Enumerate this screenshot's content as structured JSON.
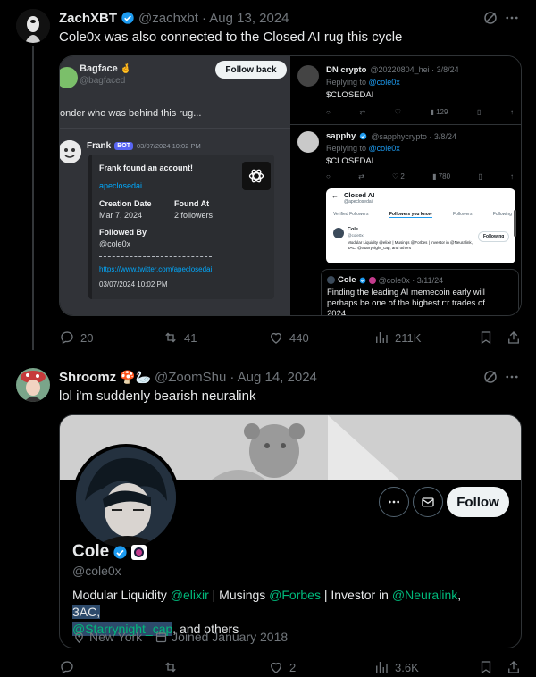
{
  "tweet1": {
    "name": "ZachXBT",
    "handle": "@zachxbt",
    "date": "· Aug 13, 2024",
    "text": "Cole0x was also connected to the Closed AI rug this cycle",
    "actions": {
      "replies": "20",
      "reposts": "41",
      "likes": "440",
      "views": "211K"
    },
    "image": {
      "discord": {
        "top_name": "Bagface",
        "top_emoji": "🤞",
        "top_handle": "@bagfaced",
        "follow_back": "Follow back",
        "quote_text": "onder who was behind this rug...",
        "bot_name": "Frank",
        "bot_tag": "BOT",
        "bot_time": "03/07/2024 10:02 PM",
        "embed_title": "Frank found an account!",
        "embed_account": "apeclosedai",
        "creation_label": "Creation Date",
        "creation_value": "Mar 7, 2024",
        "found_label": "Found At",
        "found_value": "2 followers",
        "followed_label": "Followed By",
        "followed_value": "@cole0x",
        "url": "https://www.twitter.com/apeclosedai",
        "footer_time": "03/07/2024 10:02 PM"
      },
      "replies": [
        {
          "name": "DN crypto",
          "handle": "@20220804_hei · 3/8/24",
          "replying": "Replying to",
          "replying_to": "@cole0x",
          "text": "$CLOSEDAI",
          "views": "129"
        },
        {
          "name": "sapphy",
          "handle": "@sapphycrypto · 3/8/24",
          "replying": "Replying to",
          "replying_to": "@cole0x",
          "text": "$CLOSEDAI",
          "likes": "2",
          "views": "780"
        }
      ],
      "follow_list": {
        "title": "Closed AI",
        "handle": "@apeclosedai",
        "tabs": [
          "Verified Followers",
          "Followers you know",
          "Followers",
          "Following"
        ],
        "user_name": "Cole",
        "user_handle": "@cole0x",
        "user_bio": "Modular Liquidity @elixir | Musings @Forbes | Investor in @Neuralink, 3AC, @Starrynight_cap, and others",
        "button": "Following"
      },
      "quote": {
        "name": "Cole",
        "handle": "@cole0x · 3/11/24",
        "text_line1": "Finding the leading AI memecoin early will",
        "text_line2": "perhaps be one of the highest r:r trades of",
        "text_line3": "2024"
      }
    }
  },
  "tweet2": {
    "name": "Shroomz",
    "name_emoji": "🍄🦢",
    "handle": "@ZoomShu",
    "date": "· Aug 14, 2024",
    "text": "lol i'm suddenly bearish neuralink",
    "actions": {
      "replies": "",
      "reposts": "",
      "likes": "2",
      "views": "3.6K"
    },
    "profile": {
      "name": "Cole",
      "handle": "@cole0x",
      "bio_prefix": "Modular Liquidity ",
      "bio_elixir": "@elixir",
      "bio_mid1": " | Musings ",
      "bio_forbes": "@Forbes",
      "bio_mid2": " | Investor in ",
      "bio_neuralink": "@Neuralink",
      "bio_comma": ", ",
      "bio_3ac": "3AC,",
      "bio_starry": "@Starrynight_cap",
      "bio_end": ", and others",
      "location": "New York",
      "joined": "Joined January 2018",
      "follow_label": "Follow"
    }
  },
  "colors": {
    "accent": "#1d9bf0",
    "background": "#000000",
    "muted": "#71767b",
    "verified": "#1d9bf0",
    "mention_green": "#00ba7c"
  },
  "icons": [
    "verified-badge-icon",
    "grok-icon",
    "more-icon",
    "reply-icon",
    "repost-icon",
    "like-icon",
    "views-icon",
    "bookmark-icon",
    "share-icon",
    "mail-icon",
    "location-icon",
    "calendar-icon"
  ]
}
